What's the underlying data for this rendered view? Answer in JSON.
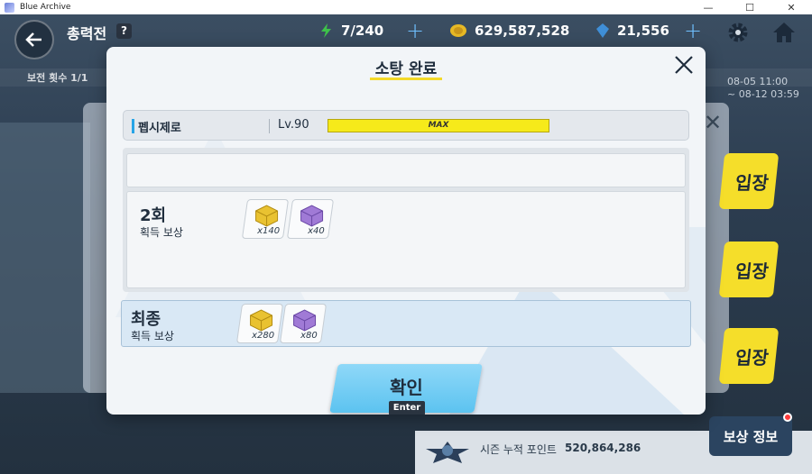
{
  "window": {
    "title": "Blue Archive",
    "minimize": "—",
    "maximize": "☐",
    "close": "✕"
  },
  "header": {
    "page_title": "총력전",
    "help": "?",
    "ap": "7/240",
    "credits": "629,587,528",
    "gems": "21,556",
    "ap_color": "#3ec24a",
    "credit_color": "#e7b925",
    "gem_color": "#3f8fd8"
  },
  "background": {
    "left_info": "보전 횟수 1/1",
    "dates": [
      "08-05 11:00",
      "~ 08-12 03:59"
    ],
    "side_buttons": [
      "입장",
      "입장",
      "입장"
    ],
    "season_label": "시즌 누적 포인트",
    "season_value": "520,864,286",
    "reward_info": "보상 정보"
  },
  "modal": {
    "title": "소탕 완료",
    "character": {
      "name": "펩시제로",
      "level": "Lv.90",
      "exp_label": "MAX",
      "exp_fill": 1.0
    },
    "rows": [
      {
        "label": "2회",
        "sub": "획득 보상",
        "items": [
          {
            "type": "gold-box-icon",
            "qty": "x140"
          },
          {
            "type": "purple-box-icon",
            "qty": "x40"
          }
        ]
      }
    ],
    "final": {
      "label": "최종",
      "sub": "획득 보상",
      "items": [
        {
          "type": "gold-box-icon",
          "qty": "x280"
        },
        {
          "type": "purple-box-icon",
          "qty": "x80"
        }
      ]
    },
    "confirm_label": "확인",
    "enter_label": "Enter"
  }
}
